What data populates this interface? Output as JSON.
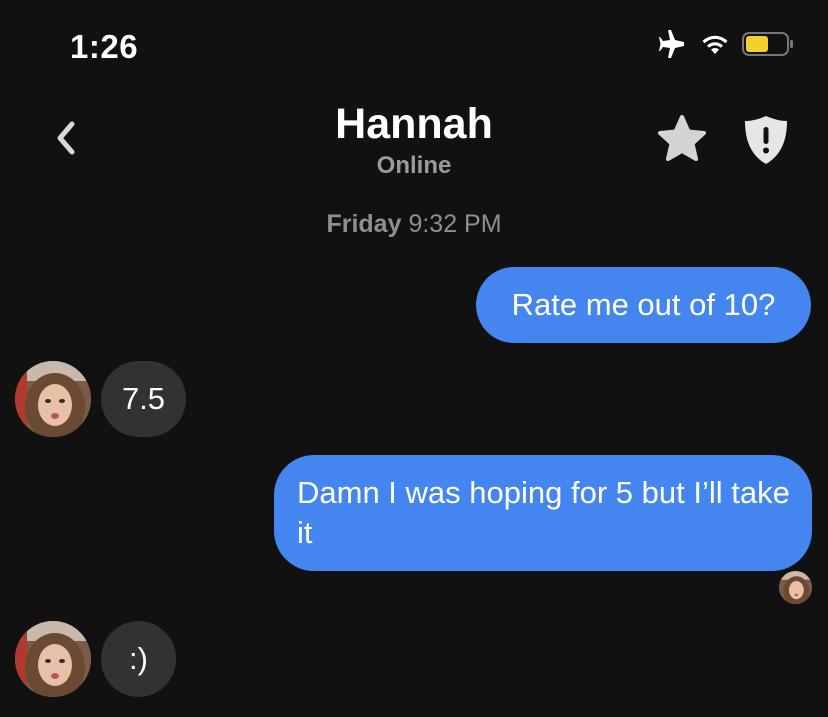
{
  "status_bar": {
    "time": "1:26",
    "icons": [
      "airplane-icon",
      "wifi-icon",
      "battery-icon"
    ],
    "battery_color": "#f4d02f"
  },
  "header": {
    "name": "Hannah",
    "status": "Online",
    "back_icon": "chevron-left-icon",
    "actions": [
      "star-icon",
      "shield-alert-icon"
    ]
  },
  "conversation": {
    "timestamp_day": "Friday",
    "timestamp_time": "9:32 PM",
    "messages": [
      {
        "direction": "outgoing",
        "text": "Rate me out of 10?"
      },
      {
        "direction": "incoming",
        "text": "7.5"
      },
      {
        "direction": "outgoing",
        "text": "Damn I was hoping for 5 but I’ll take it"
      },
      {
        "direction": "incoming",
        "text": ":)"
      }
    ]
  },
  "colors": {
    "background": "#111111",
    "outgoing_bubble": "#4485f0",
    "incoming_bubble": "#323232",
    "secondary_text": "#9a9a9a"
  }
}
